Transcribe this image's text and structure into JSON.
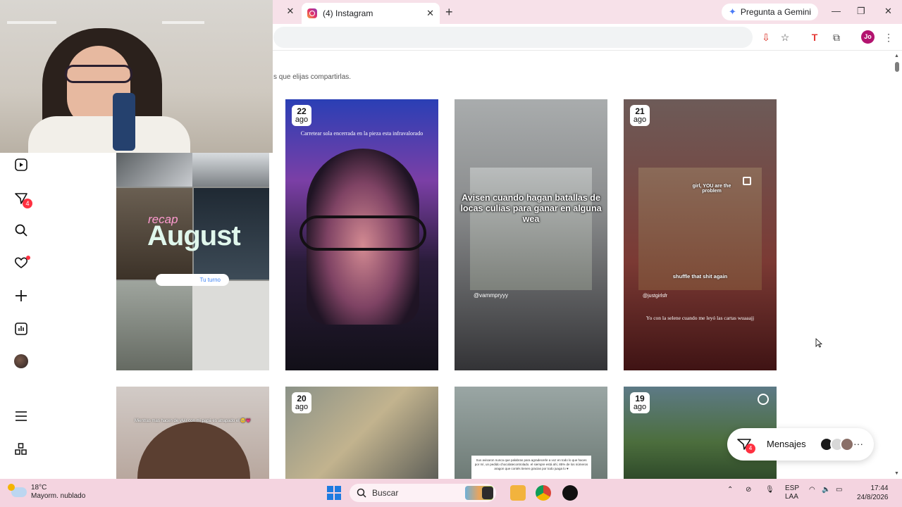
{
  "browser": {
    "tab_title": "(4) Instagram",
    "new_tab": "+",
    "gemini_label": "Pregunta a Gemini",
    "profile_initials": "Jo"
  },
  "instagram": {
    "subtitle": "s que elijas compartirlas.",
    "notifications_count": "4",
    "posts": [
      {
        "day": "",
        "mon": "",
        "recap": "recap",
        "title": "August",
        "turn": "Tu turno"
      },
      {
        "day": "22",
        "mon": "ago",
        "caption": "Carretear sola encerrada en la pieza esta infravalorado"
      },
      {
        "day": "",
        "mon": "",
        "text": "Avisen cuando hagan batallas de locas culias para ganar en alguna wea",
        "handle": "@vammpryyy"
      },
      {
        "day": "21",
        "mon": "ago",
        "text_top": "girl, YOU are the problem",
        "text_bottom": "shuffle that shit again",
        "handle": "@justgirlsfr",
        "caption": "Yo con la selene cuando me leyó las cartas wuaaajj"
      },
      {
        "day": "",
        "mon": "",
        "caption": "Mientras mas hacen de vivir con mi papá es atrapado el 🥺💗"
      },
      {
        "day": "20",
        "mon": "ago"
      },
      {
        "day": "",
        "mon": "",
        "note": "Sus avisaron nunca que palabras para agradecerle a voz en todo lo que haces por mí, un pedido chocolatecontrolado. el siempre está ahí, 85% de los números aragon que contés tienen gracias por todo juaga lo ♥"
      },
      {
        "day": "19",
        "mon": "ago"
      }
    ],
    "messages_label": "Mensajes",
    "messages_badge": "4",
    "more": "···"
  },
  "taskbar": {
    "temperature": "18°C",
    "weather": "Mayorm. nublado",
    "search_placeholder": "Buscar",
    "lang": "ESP",
    "region": "LAA",
    "time": "17:44",
    "date": "24/8/2026"
  },
  "colors": {
    "tabbar": "#f7e1e9",
    "taskbar": "#f4d4e0",
    "badge": "#ff3040",
    "profile": "#b3136f"
  }
}
